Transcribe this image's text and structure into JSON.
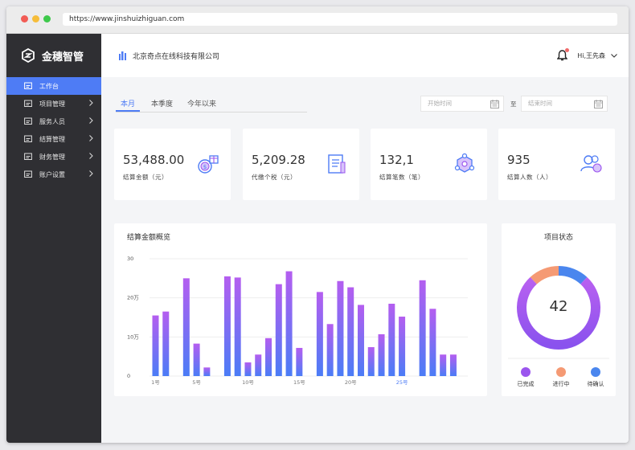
{
  "browser": {
    "url": "https://www.jinshuizhiguan.com"
  },
  "app": {
    "name": "金穗智管",
    "company": "北京奇点在线科技有限公司",
    "user": "Hi,王先森"
  },
  "sidebar": {
    "items": [
      {
        "label": "工作台",
        "icon": "dashboard-icon",
        "active": true
      },
      {
        "label": "项目管理",
        "icon": "layers-icon"
      },
      {
        "label": "服务人员",
        "icon": "person-icon"
      },
      {
        "label": "结算管理",
        "icon": "settle-icon"
      },
      {
        "label": "财务管理",
        "icon": "finance-icon"
      },
      {
        "label": "账户设置",
        "icon": "account-icon"
      }
    ]
  },
  "filters": {
    "tabs": [
      "本月",
      "本季度",
      "今年以来"
    ],
    "active_tab": 0,
    "start_placeholder": "开始时间",
    "end_placeholder": "结束时间",
    "separator": "至"
  },
  "stats": [
    {
      "value": "53,488.00",
      "label": "结算金额（元）",
      "icon": "money-gift-icon"
    },
    {
      "value": "5,209.28",
      "label": "代缴个税（元）",
      "icon": "document-icon"
    },
    {
      "value": "132,1",
      "label": "结算笔数（笔）",
      "icon": "settlement-icon"
    },
    {
      "value": "935",
      "label": "结算人数（人）",
      "icon": "people-icon"
    }
  ],
  "chart_data": {
    "type": "bar",
    "title": "结算金额概览",
    "ytick_labels": [
      "30",
      "20万",
      "10万",
      "0"
    ],
    "yticks": [
      30,
      20,
      10,
      0
    ],
    "ylim": [
      0,
      30
    ],
    "xtick_labels": [
      "1号",
      "5号",
      "10号",
      "15号",
      "20号",
      "25号"
    ],
    "xtick_days": [
      1,
      5,
      10,
      15,
      20,
      25
    ],
    "highlight_tick": "25号",
    "grid": true,
    "categories": [
      1,
      2,
      3,
      4,
      5,
      6,
      7,
      8,
      9,
      10,
      11,
      12,
      13,
      14,
      15,
      16,
      17,
      18,
      19,
      20,
      21,
      22,
      23,
      24,
      25,
      26,
      27,
      28,
      29,
      30,
      31
    ],
    "values": [
      15.5,
      16.5,
      null,
      25,
      8.3,
      2.2,
      null,
      25.5,
      25.2,
      3.5,
      5.5,
      9.7,
      23.5,
      26.8,
      7.2,
      null,
      21.5,
      13.3,
      24.3,
      22.7,
      18.2,
      7.4,
      10.7,
      18.5,
      15.2,
      null,
      24.5,
      17.2,
      5.5,
      5.5,
      null
    ],
    "colors": {
      "top": "#b45ef0",
      "bottom": "#4b7cf6"
    }
  },
  "status": {
    "title": "项目状态",
    "total": "42",
    "segments": [
      {
        "name": "已完成",
        "value": 32,
        "color": "#9b55ee"
      },
      {
        "name": "进行中",
        "value": 5,
        "color": "#f59a74"
      },
      {
        "name": "待确认",
        "value": 5,
        "color": "#4a86ee"
      }
    ]
  }
}
